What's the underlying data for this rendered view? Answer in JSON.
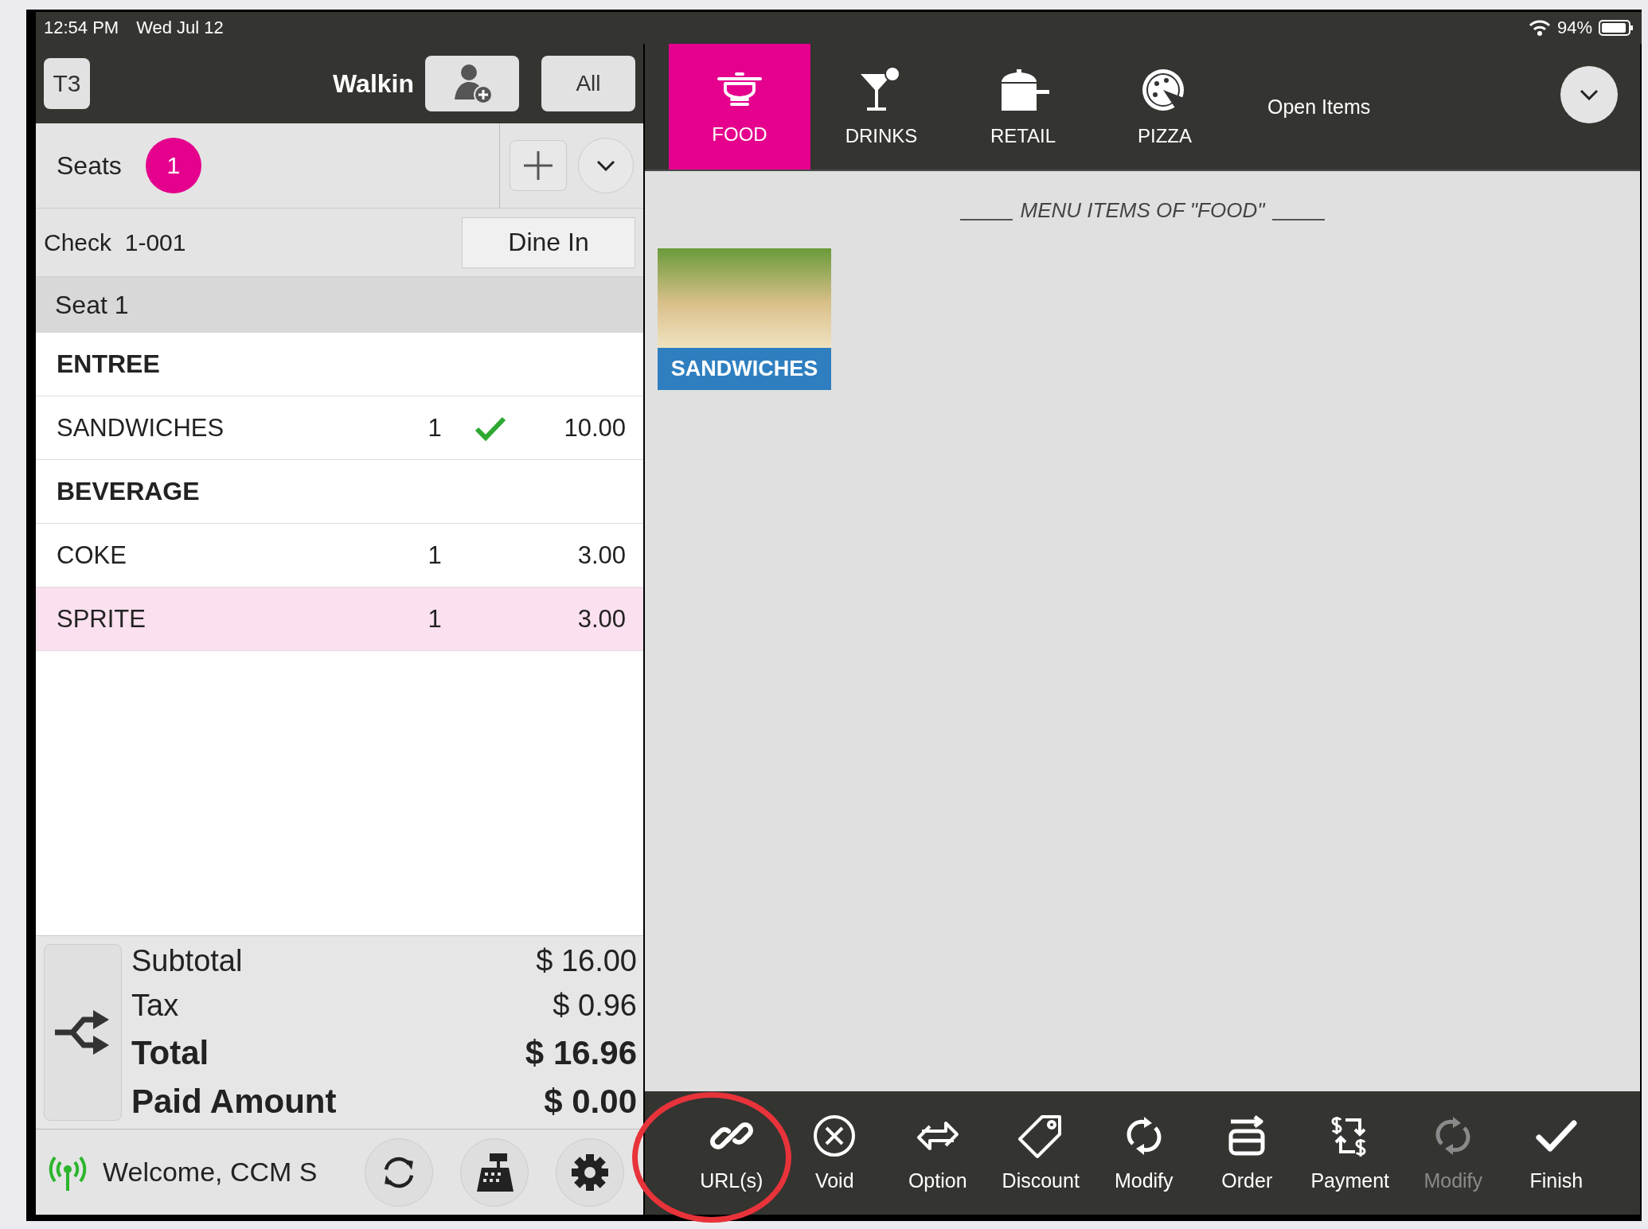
{
  "status_bar": {
    "time": "12:54 PM",
    "date": "Wed Jul 12",
    "battery": "94%"
  },
  "header": {
    "table": "T3",
    "customer": "Walkin",
    "filter": "All"
  },
  "seats": {
    "label": "Seats",
    "count": "1"
  },
  "check": {
    "label": "Check  1-001",
    "order_type": "Dine In"
  },
  "seat_header": "Seat 1",
  "order_lines": [
    {
      "kind": "group",
      "name": "ENTREE"
    },
    {
      "kind": "item",
      "name": "SANDWICHES",
      "qty": "1",
      "sent": true,
      "price": "10.00",
      "selected": false
    },
    {
      "kind": "group",
      "name": "BEVERAGE"
    },
    {
      "kind": "item",
      "name": "COKE",
      "qty": "1",
      "sent": false,
      "price": "3.00",
      "selected": false
    },
    {
      "kind": "item",
      "name": "SPRITE",
      "qty": "1",
      "sent": false,
      "price": "3.00",
      "selected": true
    }
  ],
  "totals": [
    {
      "kind": "normal",
      "label": "Subtotal",
      "amount": "$ 16.00"
    },
    {
      "kind": "normal",
      "label": "Tax",
      "amount": "$ 0.96"
    },
    {
      "kind": "bold",
      "label": "Total",
      "amount": "$ 16.96"
    },
    {
      "kind": "bold",
      "label": "Paid Amount",
      "amount": "$ 0.00"
    }
  ],
  "footer": {
    "welcome": "Welcome, CCM S"
  },
  "categories": [
    {
      "label": "FOOD",
      "selected": true
    },
    {
      "label": "DRINKS",
      "selected": false
    },
    {
      "label": "RETAIL",
      "selected": false
    },
    {
      "label": "PIZZA",
      "selected": false
    }
  ],
  "open_items": "Open Items",
  "menu_title": "MENU ITEMS OF \"FOOD\"",
  "menu_items": [
    {
      "label": "SANDWICHES"
    }
  ],
  "toolbar": [
    {
      "label": "URL(s)",
      "disabled": false
    },
    {
      "label": "Void",
      "disabled": false
    },
    {
      "label": "Option",
      "disabled": false
    },
    {
      "label": "Discount",
      "disabled": false
    },
    {
      "label": "Modify",
      "disabled": false
    },
    {
      "label": "Order",
      "disabled": false
    },
    {
      "label": "Payment",
      "disabled": false
    },
    {
      "label": "Modify",
      "disabled": true
    },
    {
      "label": "Finish",
      "disabled": false
    }
  ]
}
